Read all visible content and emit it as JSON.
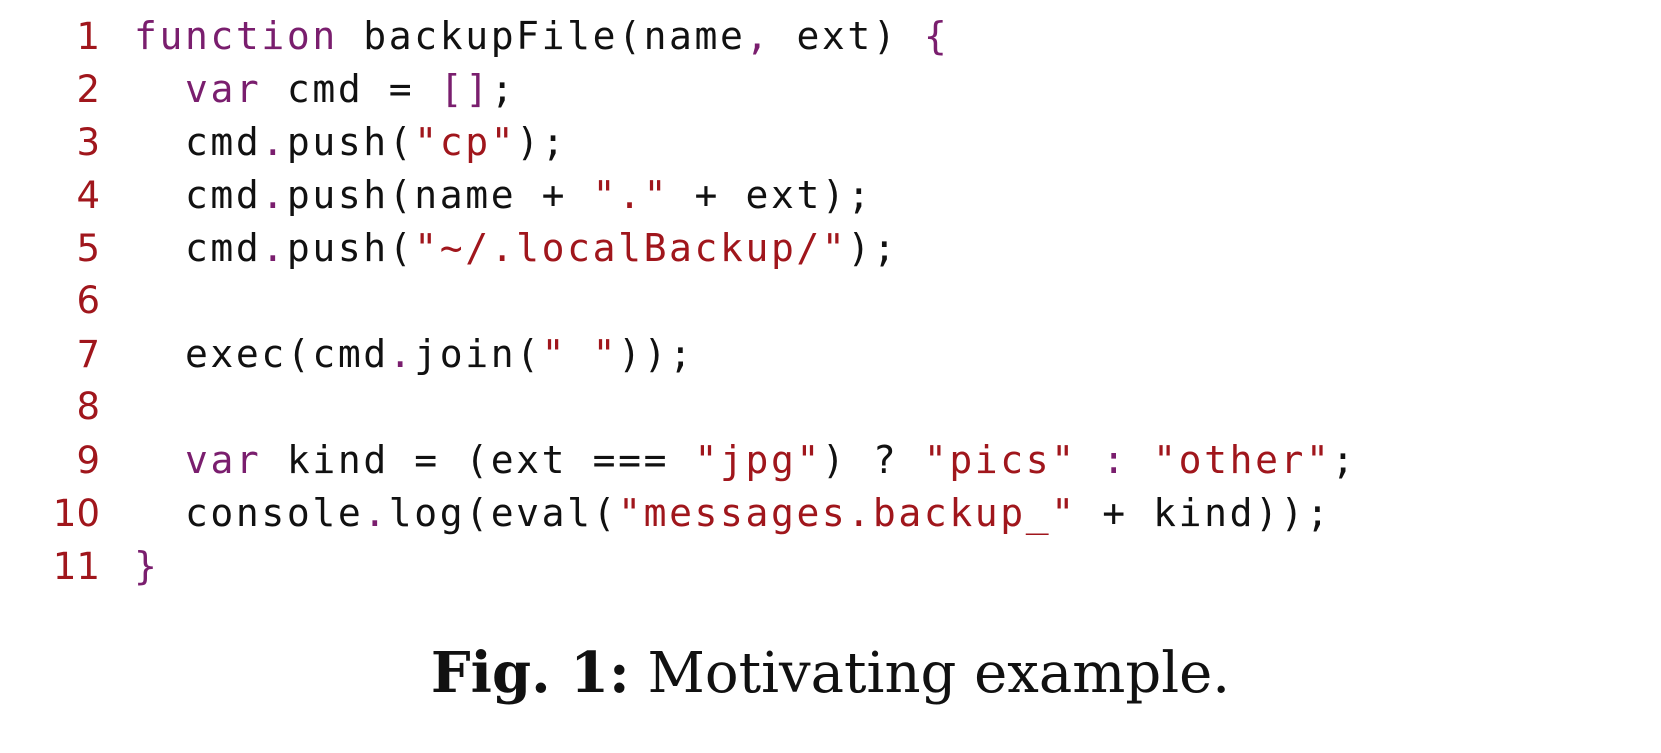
{
  "colors": {
    "keyword": "#7a1e6e",
    "string": "#a0161c",
    "line_number": "#a0161c",
    "plain": "#111111"
  },
  "code": {
    "lines": [
      {
        "number": "1",
        "tokens": [
          {
            "type": "keyword",
            "text": "function"
          },
          {
            "type": "plain",
            "text": " backupFile(name"
          },
          {
            "type": "punct",
            "text": ","
          },
          {
            "type": "plain",
            "text": " ext) "
          },
          {
            "type": "punct",
            "text": "{"
          }
        ]
      },
      {
        "number": "2",
        "tokens": [
          {
            "type": "plain",
            "text": "  "
          },
          {
            "type": "keyword",
            "text": "var"
          },
          {
            "type": "plain",
            "text": " cmd = "
          },
          {
            "type": "punct",
            "text": "[]"
          },
          {
            "type": "plain",
            "text": ";"
          }
        ]
      },
      {
        "number": "3",
        "tokens": [
          {
            "type": "plain",
            "text": "  cmd"
          },
          {
            "type": "punct",
            "text": "."
          },
          {
            "type": "plain",
            "text": "push("
          },
          {
            "type": "string",
            "text": "\"cp\""
          },
          {
            "type": "plain",
            "text": ");"
          }
        ]
      },
      {
        "number": "4",
        "tokens": [
          {
            "type": "plain",
            "text": "  cmd"
          },
          {
            "type": "punct",
            "text": "."
          },
          {
            "type": "plain",
            "text": "push(name + "
          },
          {
            "type": "string",
            "text": "\".\""
          },
          {
            "type": "plain",
            "text": " + ext);"
          }
        ]
      },
      {
        "number": "5",
        "tokens": [
          {
            "type": "plain",
            "text": "  cmd"
          },
          {
            "type": "punct",
            "text": "."
          },
          {
            "type": "plain",
            "text": "push("
          },
          {
            "type": "string",
            "text": "\"~/.localBackup/\""
          },
          {
            "type": "plain",
            "text": ");"
          }
        ]
      },
      {
        "number": "6",
        "tokens": []
      },
      {
        "number": "7",
        "tokens": [
          {
            "type": "plain",
            "text": "  exec(cmd"
          },
          {
            "type": "punct",
            "text": "."
          },
          {
            "type": "plain",
            "text": "join("
          },
          {
            "type": "string",
            "text": "\" \""
          },
          {
            "type": "plain",
            "text": "));"
          }
        ]
      },
      {
        "number": "8",
        "tokens": []
      },
      {
        "number": "9",
        "tokens": [
          {
            "type": "plain",
            "text": "  "
          },
          {
            "type": "keyword",
            "text": "var"
          },
          {
            "type": "plain",
            "text": " kind = (ext === "
          },
          {
            "type": "string",
            "text": "\"jpg\""
          },
          {
            "type": "plain",
            "text": ") ? "
          },
          {
            "type": "string",
            "text": "\"pics\""
          },
          {
            "type": "plain",
            "text": " "
          },
          {
            "type": "punct",
            "text": ":"
          },
          {
            "type": "plain",
            "text": " "
          },
          {
            "type": "string",
            "text": "\"other\""
          },
          {
            "type": "plain",
            "text": ";"
          }
        ]
      },
      {
        "number": "10",
        "tokens": [
          {
            "type": "plain",
            "text": "  console"
          },
          {
            "type": "punct",
            "text": "."
          },
          {
            "type": "plain",
            "text": "log(eval("
          },
          {
            "type": "string",
            "text": "\"messages.backup_\""
          },
          {
            "type": "plain",
            "text": " + kind));"
          }
        ]
      },
      {
        "number": "11",
        "tokens": [
          {
            "type": "punct",
            "text": "}"
          }
        ]
      }
    ]
  },
  "caption": {
    "label": "Fig. 1:",
    "text": " Motivating example."
  }
}
